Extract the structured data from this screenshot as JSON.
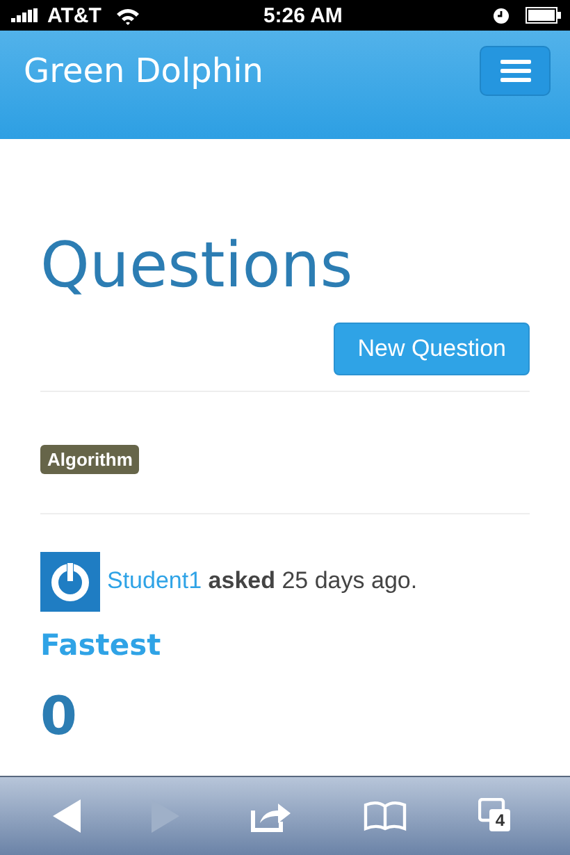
{
  "status_bar": {
    "carrier": "AT&T",
    "time": "5:26 AM"
  },
  "navbar": {
    "brand": "Green Dolphin"
  },
  "page": {
    "heading": "Questions",
    "new_button": "New Question"
  },
  "tags": [
    {
      "label": "Algorithm"
    }
  ],
  "question": {
    "author": "Student1",
    "action": "asked",
    "time": "25 days ago.",
    "title": "Fastest",
    "votes": "0"
  },
  "toolbar": {
    "back_disabled": false,
    "forward_disabled": true,
    "tab_count": "4"
  }
}
